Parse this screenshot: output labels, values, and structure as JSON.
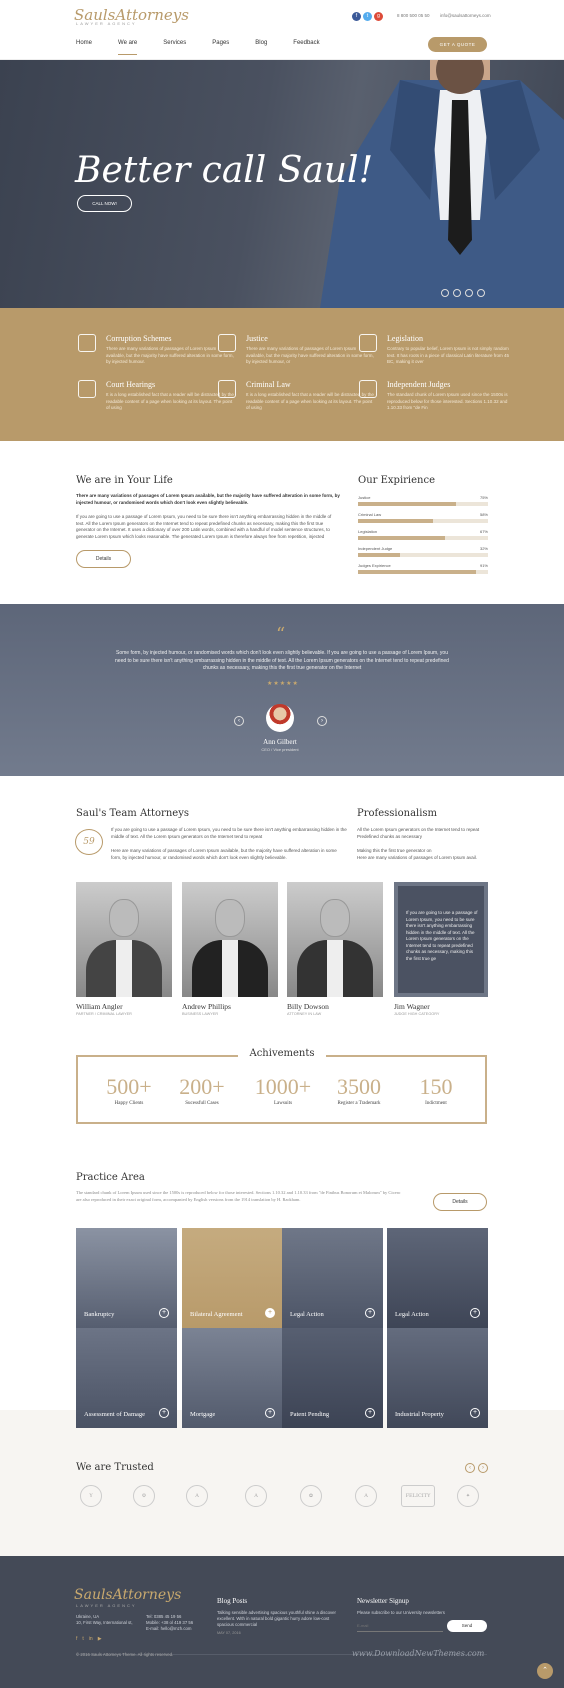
{
  "header": {
    "logo": "SaulsAttorneys",
    "logo_sub": "LAWYER AGENCY",
    "phone": "8 800 500 05 50",
    "email": "info@saulsattorneys.com",
    "nav": [
      "Home",
      "We are",
      "Services",
      "Pages",
      "Blog",
      "Feedback"
    ],
    "quote_button": "GET A QUOTE",
    "social_icons": [
      "facebook-icon",
      "twitter-icon",
      "google-plus-icon"
    ]
  },
  "hero": {
    "title": "Better call Saul!",
    "button": "CALL NOW!"
  },
  "services": [
    {
      "title": "Corruption Schemes",
      "text": "There are many variations of passages of Lorem Ipsum available, but the majority have suffered alteration in some form, by injected humour.",
      "icon": "dollar-icon"
    },
    {
      "title": "Justice",
      "text": "There are many variations of passages of Lorem Ipsum available, but the majority have suffered alteration in some form, by injected humour, or",
      "icon": "scales-icon"
    },
    {
      "title": "Legislation",
      "text": "Contrary to popular belief, Lorem Ipsum is not simply random text. It has roots in a piece of classical Latin literature from 45 BC, making it over",
      "icon": "scroll-icon"
    },
    {
      "title": "Court Hearings",
      "text": "It is a long established fact that a reader will be distracted by the readable content of a page when looking at its layout. The point of using",
      "icon": "courthouse-icon"
    },
    {
      "title": "Criminal Law",
      "text": "It is a long established fact that a reader will be distracted by the readable content of a page when looking at its layout. The point of using",
      "icon": "prison-icon"
    },
    {
      "title": "Independent Judges",
      "text": "The standard chunk of Lorem Ipsum used since the 1500s is reproduced below for those interested. Sections 1.10.32 and 1.10.33 from \"de Fin",
      "icon": "judge-icon"
    }
  ],
  "about": {
    "title": "We are in Your Life",
    "intro": "There are many variations of passages of Lorem Ipsum available, but the majority have suffered alteration in some form, by injected humour, or randomised words which don't look even slightly believable.",
    "body": "If you are going to use a passage of Lorem Ipsum, you need to be sure there isn't anything embarrassing hidden in the middle of text. All the Lorem Ipsum generators on the Internet tend to repeat predefined chunks as necessary, making this the first true generator on the Internet. It uses a dictionary of over 200 Latin words, combined with a handful of model sentence structures, to generate Lorem Ipsum which looks reasonable. The generated Lorem Ipsum is therefore always free from repetition, injected",
    "button": "Details"
  },
  "experience": {
    "title": "Our Expirience",
    "skills": [
      {
        "name": "Justice",
        "value": "75%",
        "fill": 0.75
      },
      {
        "name": "Criminal Law",
        "value": "58%",
        "fill": 0.58
      },
      {
        "name": "Legislation",
        "value": "67%",
        "fill": 0.67
      },
      {
        "name": "Independent Judge",
        "value": "32%",
        "fill": 0.32
      },
      {
        "name": "Judges Expirience",
        "value": "91%",
        "fill": 0.91
      }
    ]
  },
  "testimonial": {
    "text": "Some form, by injected humour, or randomised words which don't look even slightly believable. If you are going to use a passage of Lorem Ipsum, you need to be sure there isn't anything embarrassing hidden in the middle of text. All the Lorem Ipsum generators on the Internet tend to repeat predefined chunks as necessary, making this the first true generator on the Internet",
    "stars": "★★★★★",
    "name": "Ann Gilbert",
    "role": "CEO / Vice president"
  },
  "team": {
    "title": "Saul's Team Attorneys",
    "badge": "59",
    "p1": "If you are going to use a passage of Lorem Ipsum, you need to be sure there isn't anything embarrassing hidden in the middle of text. All the Lorem Ipsum generators on the Internet tend to repeat",
    "p2": "Here are many variations of passages of Lorem Ipsum available, but the majority have suffered alteration in some form, by injected humour, or randomised words which don't look even slightly believable.",
    "members": [
      {
        "name": "William Angler",
        "role": "PARTNER / CRIMINAL LAWYER"
      },
      {
        "name": "Andrew Phillips",
        "role": "BUSINESS LAWYER"
      },
      {
        "name": "Billy Dowson",
        "role": "ATTORNEY IN LAW"
      },
      {
        "name": "Jim Wagner",
        "role": "JUDGE HIGH CATEGORY"
      }
    ],
    "card_text": "If you are going to use a passage of Lorem Ipsum, you need to be sure there isn't anything embarrassing hidden in the middle of text. All the Lorem Ipsum generators on the Internet tend to repeat predefined chunks as necessary, making this the first true ge"
  },
  "professionalism": {
    "title": "Professionalism",
    "p1": "All the Lorem Ipsum generators on the Internet tend to repeat Predefined chunks as necessary",
    "p2": "Making this the first true generator on",
    "p3": "Here are many variations of passages of Lorem Ipsum avail."
  },
  "achievements": {
    "title": "Achivements",
    "items": [
      {
        "num": "500+",
        "label": "Happy Clients"
      },
      {
        "num": "200+",
        "label": "Sucessfull Cases"
      },
      {
        "num": "1000+",
        "label": "Lawsuits"
      },
      {
        "num": "3500",
        "label": "Register a Trademark"
      },
      {
        "num": "150",
        "label": "Indictment"
      }
    ]
  },
  "practice": {
    "title": "Practice Area",
    "text": "The standard chunk of Lorem Ipsum used since the 1500s is reproduced below for those interested. Sections 1.10.32 and 1.10.33 from \"de Finibus Bonorum et Malorum\" by Cicero are also reproduced in their exact original form, accompanied by English versions from the 1914 translation by H. Rackham.",
    "button": "Details",
    "tiles": [
      "Bankruptcy",
      "Bilateral Agreement",
      "Legal Action",
      "Legal Action",
      "Assessment of Damage",
      "Mortgage",
      "Patent Pending",
      "Industrial Property"
    ]
  },
  "trusted": {
    "title": "We are Trusted",
    "logos": [
      "Y",
      "⚙",
      "A",
      "A",
      "✿",
      "A",
      "FELICITY",
      "✦"
    ]
  },
  "footer": {
    "logo": "SaulsAttorneys",
    "logo_sub": "LAWYER AGENCY",
    "address": "Ukraine, UA",
    "address2": "10, First Way, International st,",
    "tel": "Tel: 0385 45 19 56",
    "mobile": "Mobile: +38 ol 419 37 56",
    "email": "E-mail: hello@mzh.com",
    "blog_title": "Blog Posts",
    "blog_text": "Talking sensible advertising spacious youthful shine a discover excellent. With in natural bold gigantic hurry adore low-cost spacious commercial",
    "blog_date": "MAY 07, 2016",
    "newsletter_title": "Newsletter Signup",
    "newsletter_text": "Please subscribe to our University newsletters",
    "newsletter_placeholder": "E-mail",
    "send": "Send",
    "copyright": "© 2016 Sauls Attorneys Theme. All rights reserved.",
    "watermark": "www.DownloadNewThemes.com"
  },
  "colors": {
    "gold": "#b89a6a",
    "dark": "#444a57",
    "slate": "#5d6679"
  }
}
